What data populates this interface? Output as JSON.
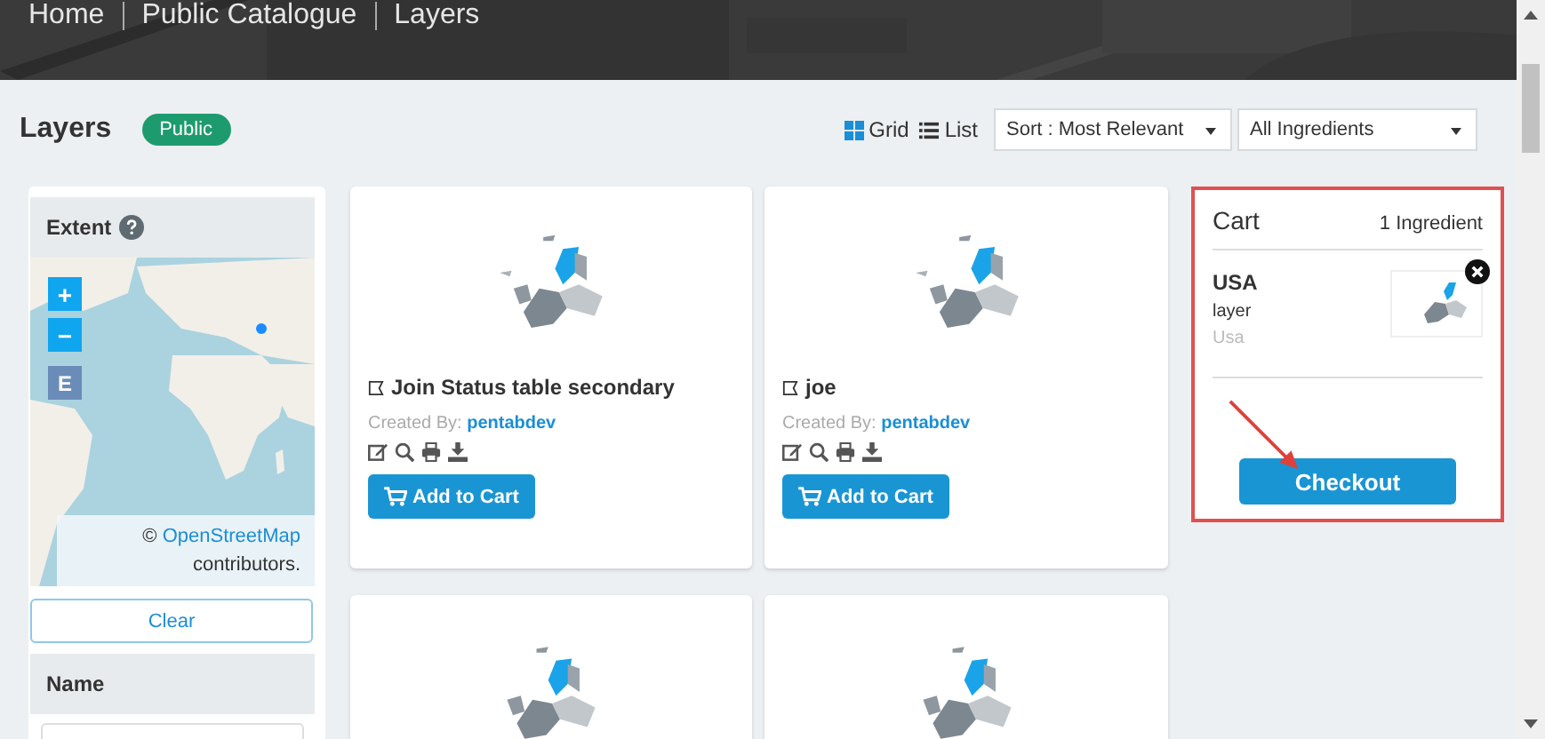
{
  "breadcrumb": [
    "Home",
    "Public Catalogue",
    "Layers"
  ],
  "page_title": "Layers",
  "badge": "Public",
  "views": [
    {
      "label": "Grid",
      "selected": true
    },
    {
      "label": "List",
      "selected": false
    }
  ],
  "sort": "Sort : Most Relevant",
  "filter": "All Ingredients",
  "extent": {
    "title": "Extent",
    "zoom_in": "+",
    "zoom_out": "−",
    "extent_button": "E",
    "attribution_symbol": "©",
    "attribution_link": "OpenStreetMap",
    "attribution_text": "contributors.",
    "clear": "Clear"
  },
  "name_filter": {
    "title": "Name"
  },
  "cards": [
    {
      "title": "Join Status table secondary",
      "created_label": "Created By:",
      "author": "pentabdev",
      "button": "Add to Cart"
    },
    {
      "title": "joe",
      "created_label": "Created By:",
      "author": "pentabdev",
      "button": "Add to Cart"
    }
  ],
  "cart": {
    "title": "Cart",
    "count": "1 Ingredient",
    "items": [
      {
        "name": "USA",
        "type": "layer",
        "subtitle": "Usa"
      }
    ],
    "checkout": "Checkout"
  }
}
